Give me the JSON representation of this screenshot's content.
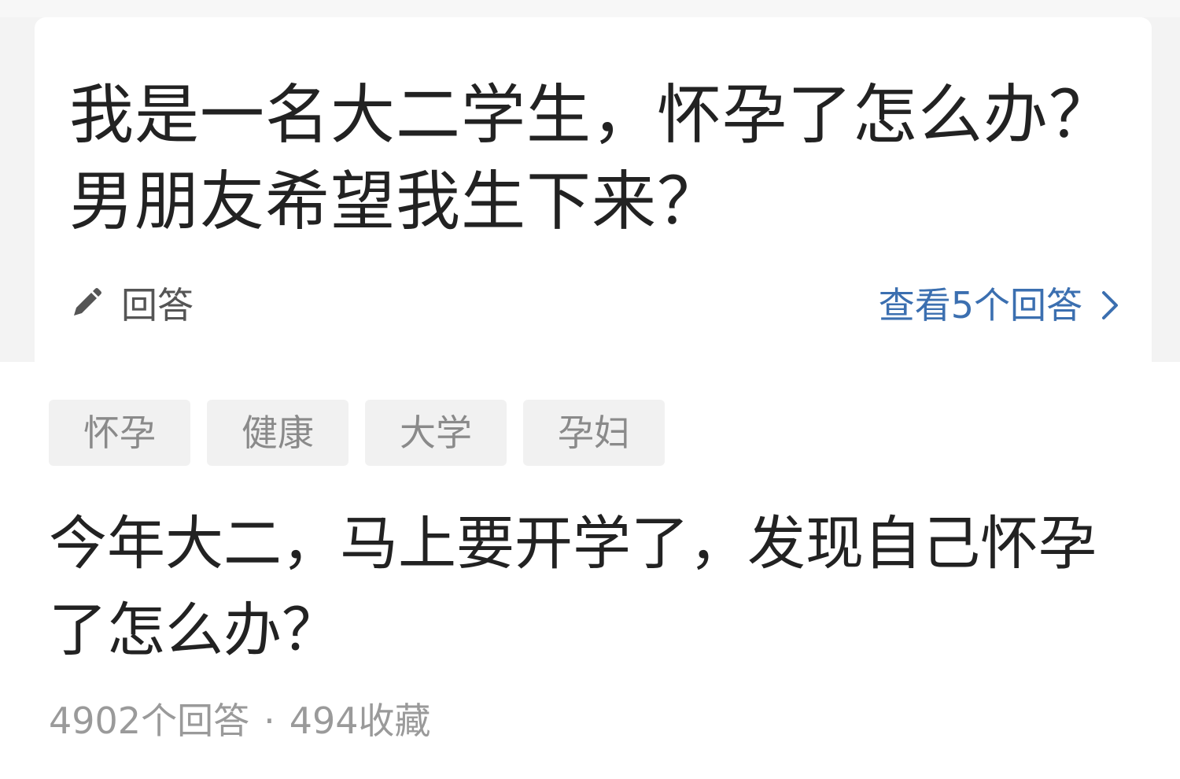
{
  "card": {
    "title": "我是一名大二学生，怀孕了怎么办？男朋友希望我生下来？",
    "answer_button": {
      "icon": "pencil-icon",
      "label": "回答"
    },
    "view_answers": {
      "label": "查看5个回答",
      "icon": "chevron-right-icon",
      "color": "#3b6fb0"
    }
  },
  "tags": [
    "怀孕",
    "健康",
    "大学",
    "孕妇"
  ],
  "question": {
    "title": "今年大二，马上要开学了，发现自己怀孕了怎么办？",
    "answer_count": "4902个回答",
    "separator": "·",
    "favorites": "494收藏"
  }
}
